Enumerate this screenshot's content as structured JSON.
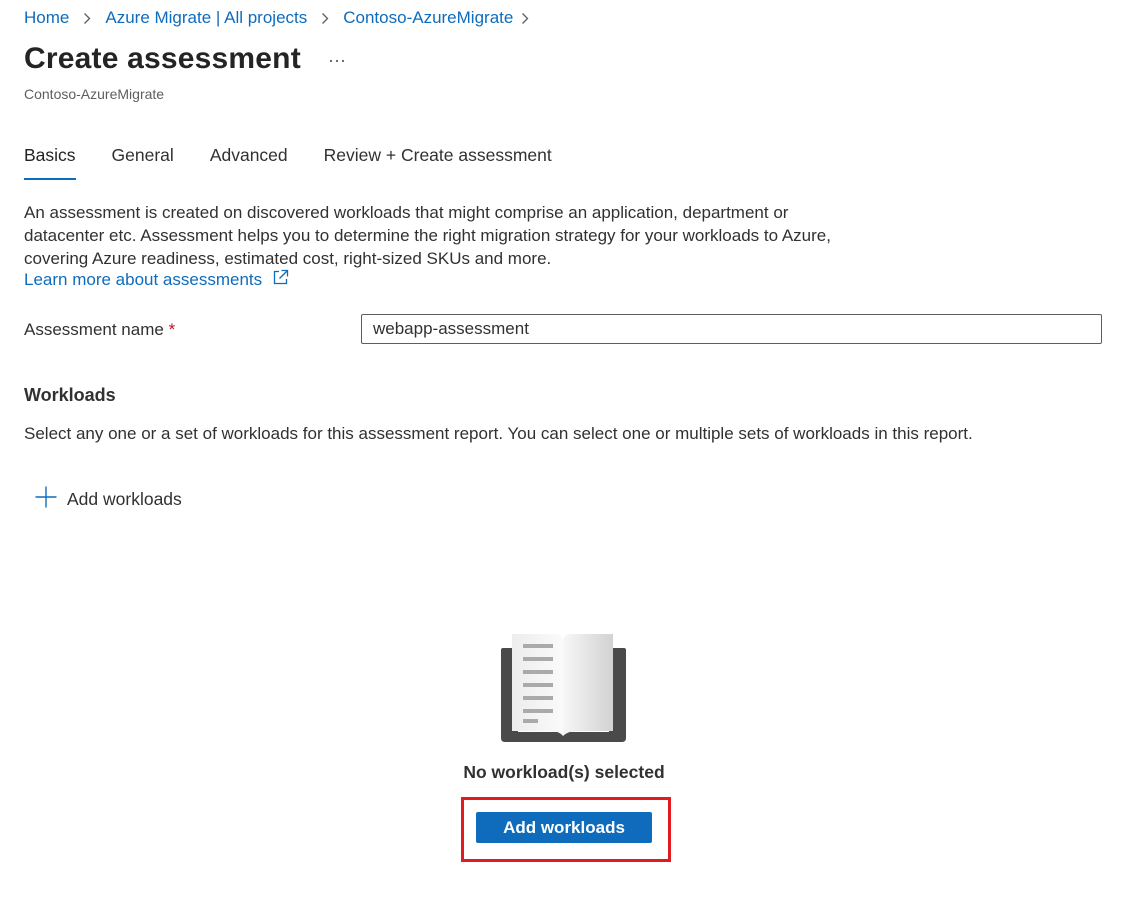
{
  "breadcrumb": {
    "items": [
      "Home",
      "Azure Migrate | All projects",
      "Contoso-AzureMigrate"
    ]
  },
  "header": {
    "title": "Create assessment",
    "more_label": "...",
    "subtitle": "Contoso-AzureMigrate"
  },
  "tabs": [
    {
      "label": "Basics",
      "active": true
    },
    {
      "label": "General",
      "active": false
    },
    {
      "label": "Advanced",
      "active": false
    },
    {
      "label": "Review + Create assessment",
      "active": false
    }
  ],
  "intro": {
    "description": "An assessment is created on discovered workloads that might comprise an application, department or datacenter etc. Assessment helps you to determine the right migration strategy for your workloads to Azure, covering Azure readiness, estimated cost, right-sized SKUs and more.",
    "learn_more": "Learn more about assessments"
  },
  "form": {
    "assessment_name_label": "Assessment name",
    "required_mark": "*",
    "assessment_name_value": "webapp-assessment"
  },
  "workloads": {
    "title": "Workloads",
    "description": "Select any one or a set of workloads for this assessment report. You can select one or multiple sets of workloads in this report.",
    "add_link": "Add workloads",
    "empty_message": "No workload(s) selected",
    "add_button": "Add workloads"
  },
  "icons": {
    "breadcrumb_separator": "chevron-right-icon",
    "external_link": "external-link-icon",
    "add": "plus-icon",
    "empty_state": "open-book-icon"
  },
  "colors": {
    "accent": "#0f6cbd",
    "highlight": "#e21b23",
    "required": "#c50f1f",
    "text": "#323130"
  }
}
